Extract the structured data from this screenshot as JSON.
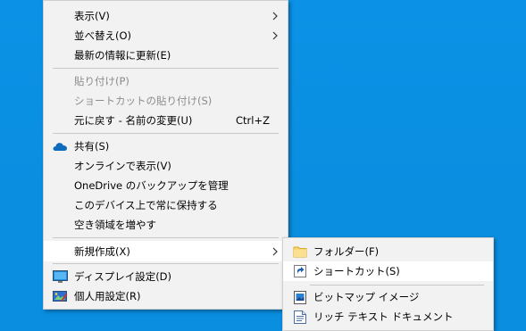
{
  "context_menu": {
    "items": [
      {
        "label": "表示(V)"
      },
      {
        "label": "並べ替え(O)"
      },
      {
        "label": "最新の情報に更新(E)"
      },
      {
        "label": "貼り付け(P)"
      },
      {
        "label": "ショートカットの貼り付け(S)"
      },
      {
        "label": "元に戻す - 名前の変更(U)",
        "shortcut": "Ctrl+Z"
      },
      {
        "label": "共有(S)",
        "icon": "onedrive-cloud-icon"
      },
      {
        "label": "オンラインで表示(V)"
      },
      {
        "label": "OneDrive のバックアップを管理"
      },
      {
        "label": "このデバイス上で常に保持する"
      },
      {
        "label": "空き領域を増やす"
      },
      {
        "label": "新規作成(X)"
      },
      {
        "label": "ディスプレイ設定(D)",
        "icon": "display-settings-icon"
      },
      {
        "label": "個人用設定(R)",
        "icon": "personalize-icon"
      }
    ]
  },
  "new_submenu": {
    "items": [
      {
        "label": "フォルダー(F)",
        "icon": "folder-icon"
      },
      {
        "label": "ショートカット(S)",
        "icon": "shortcut-icon"
      },
      {
        "label": "ビットマップ イメージ",
        "icon": "bitmap-image-icon"
      },
      {
        "label": "リッチ テキスト ドキュメント",
        "icon": "rich-text-document-icon"
      }
    ]
  },
  "colors": {
    "desktop": "#0a8ee0",
    "menu_bg": "#f2f2f2",
    "hover_bg": "#ffffff",
    "disabled_text": "#8c8c8c"
  }
}
